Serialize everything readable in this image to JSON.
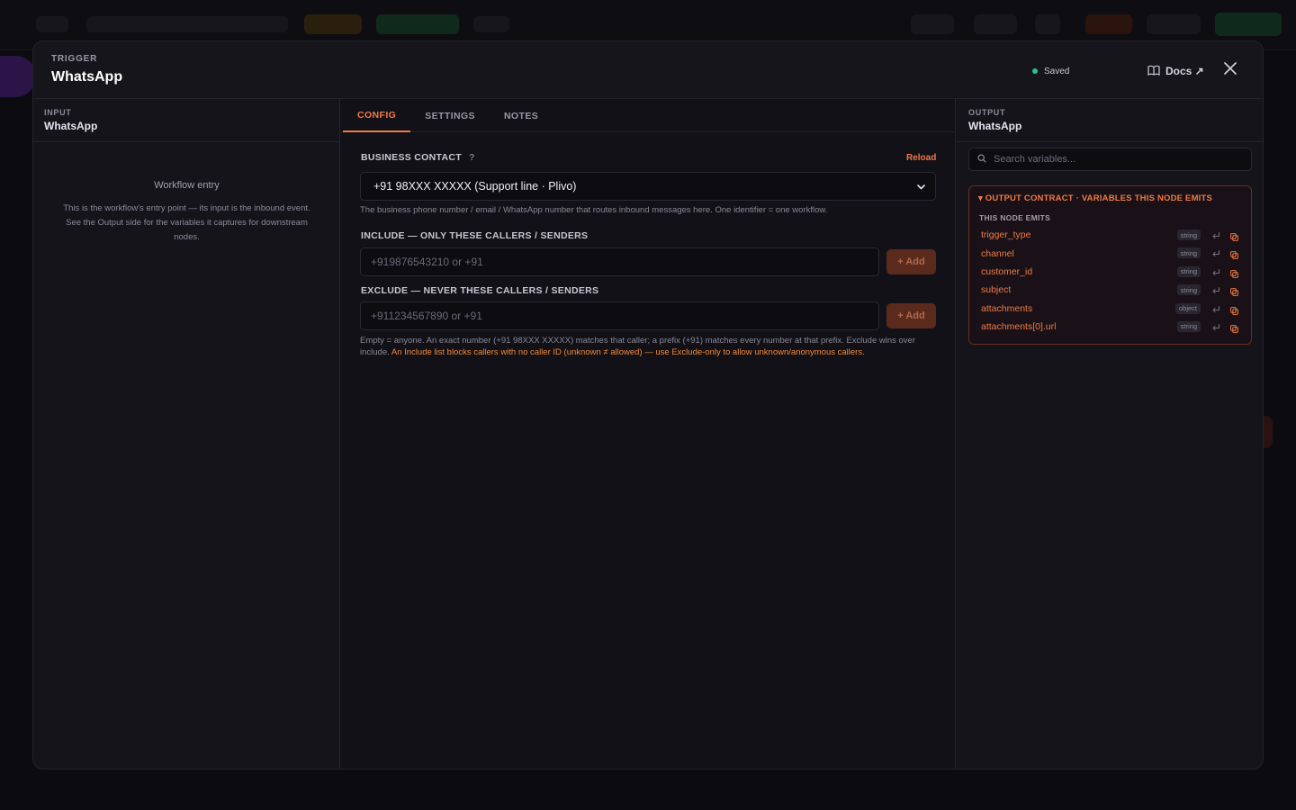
{
  "header": {
    "kicker": "TRIGGER",
    "title": "WhatsApp",
    "status": "Saved",
    "docs_label": "Docs ↗"
  },
  "input_pane": {
    "kicker": "INPUT",
    "title": "WhatsApp",
    "entry_title": "Workflow entry",
    "entry_desc": "This is the workflow's entry point — its input is the inbound event. See the Output side for the variables it captures for downstream nodes."
  },
  "tabs": [
    {
      "label": "CONFIG",
      "active": true
    },
    {
      "label": "SETTINGS",
      "active": false
    },
    {
      "label": "NOTES",
      "active": false
    }
  ],
  "config": {
    "business_contact_label": "BUSINESS CONTACT",
    "help_symbol": "?",
    "reload_label": "Reload",
    "business_contact_value": "+91 98XXX XXXXX (Support line · Plivo)",
    "business_contact_hint": "The business phone number / email / WhatsApp number that routes inbound messages here. One identifier = one workflow.",
    "include_label": "INCLUDE — ONLY THESE CALLERS / SENDERS",
    "include_placeholder": "+919876543210 or +91",
    "exclude_label": "EXCLUDE — NEVER THESE CALLERS / SENDERS",
    "exclude_placeholder": "+911234567890 or +91",
    "add_label": "+ Add",
    "note_text": "Empty = anyone. An exact number (+91 98XXX XXXXX) matches that caller; a prefix (+91) matches every number at that prefix. Exclude wins over include.",
    "note_warning": "An Include list blocks callers with no caller ID (unknown ≠ allowed) — use Exclude-only to allow unknown/anonymous callers."
  },
  "output_pane": {
    "kicker": "OUTPUT",
    "title": "WhatsApp",
    "search_placeholder": "Search variables...",
    "contract_title": "▾ OUTPUT CONTRACT · VARIABLES THIS NODE EMITS",
    "contract_sub": "THIS NODE EMITS",
    "variables": [
      {
        "name": "trigger_type",
        "type": "string"
      },
      {
        "name": "channel",
        "type": "string"
      },
      {
        "name": "customer_id",
        "type": "string"
      },
      {
        "name": "subject",
        "type": "string"
      },
      {
        "name": "attachments",
        "type": "object"
      },
      {
        "name": "attachments[0].url",
        "type": "string"
      }
    ]
  },
  "colors": {
    "accent": "#f07a45",
    "saved_dot": "#22c58a",
    "warning": "#f08a3c"
  }
}
